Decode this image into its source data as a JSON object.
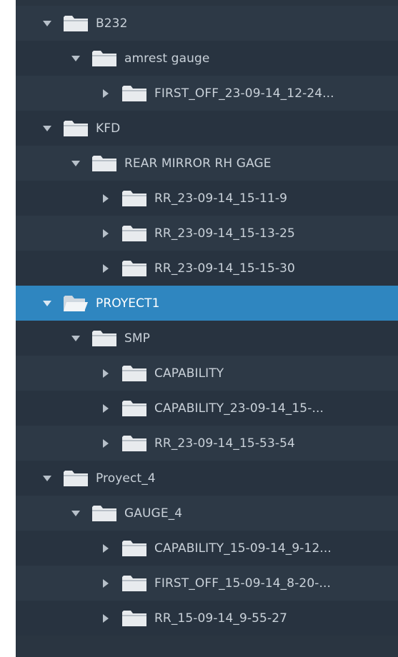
{
  "tree": {
    "nodes": [
      {
        "label": "B232",
        "expanded": true
      },
      {
        "label": "amrest gauge",
        "expanded": true
      },
      {
        "label": "FIRST_OFF_23-09-14_12-24...",
        "expanded": false
      },
      {
        "label": "KFD",
        "expanded": true
      },
      {
        "label": "REAR MIRROR RH GAGE",
        "expanded": true
      },
      {
        "label": "RR_23-09-14_15-11-9",
        "expanded": false
      },
      {
        "label": "RR_23-09-14_15-13-25",
        "expanded": false
      },
      {
        "label": "RR_23-09-14_15-15-30",
        "expanded": false
      },
      {
        "label": "PROYECT1",
        "expanded": true,
        "selected": true
      },
      {
        "label": "SMP",
        "expanded": true
      },
      {
        "label": "CAPABILITY",
        "expanded": false
      },
      {
        "label": "CAPABILITY_23-09-14_15-...",
        "expanded": false
      },
      {
        "label": "RR_23-09-14_15-53-54",
        "expanded": false
      },
      {
        "label": "Proyect_4",
        "expanded": true
      },
      {
        "label": "GAUGE_4",
        "expanded": true
      },
      {
        "label": "CAPABILITY_15-09-14_9-12...",
        "expanded": false
      },
      {
        "label": "FIRST_OFF_15-09-14_8-20-...",
        "expanded": false
      },
      {
        "label": "RR_15-09-14_9-55-27",
        "expanded": false
      }
    ]
  },
  "colors": {
    "panel_bg": "#2a3541",
    "row_odd": "#2d3946",
    "row_even": "#283340",
    "selected_bg": "#2f86c0",
    "text": "#c9d1d9",
    "folder_body": "#e8ebee",
    "folder_shade": "#b9c0c7",
    "arrow": "#b7c0c9"
  },
  "icons": {
    "expanded": "caret-down-icon",
    "collapsed": "caret-right-icon",
    "node": "folder-icon"
  }
}
